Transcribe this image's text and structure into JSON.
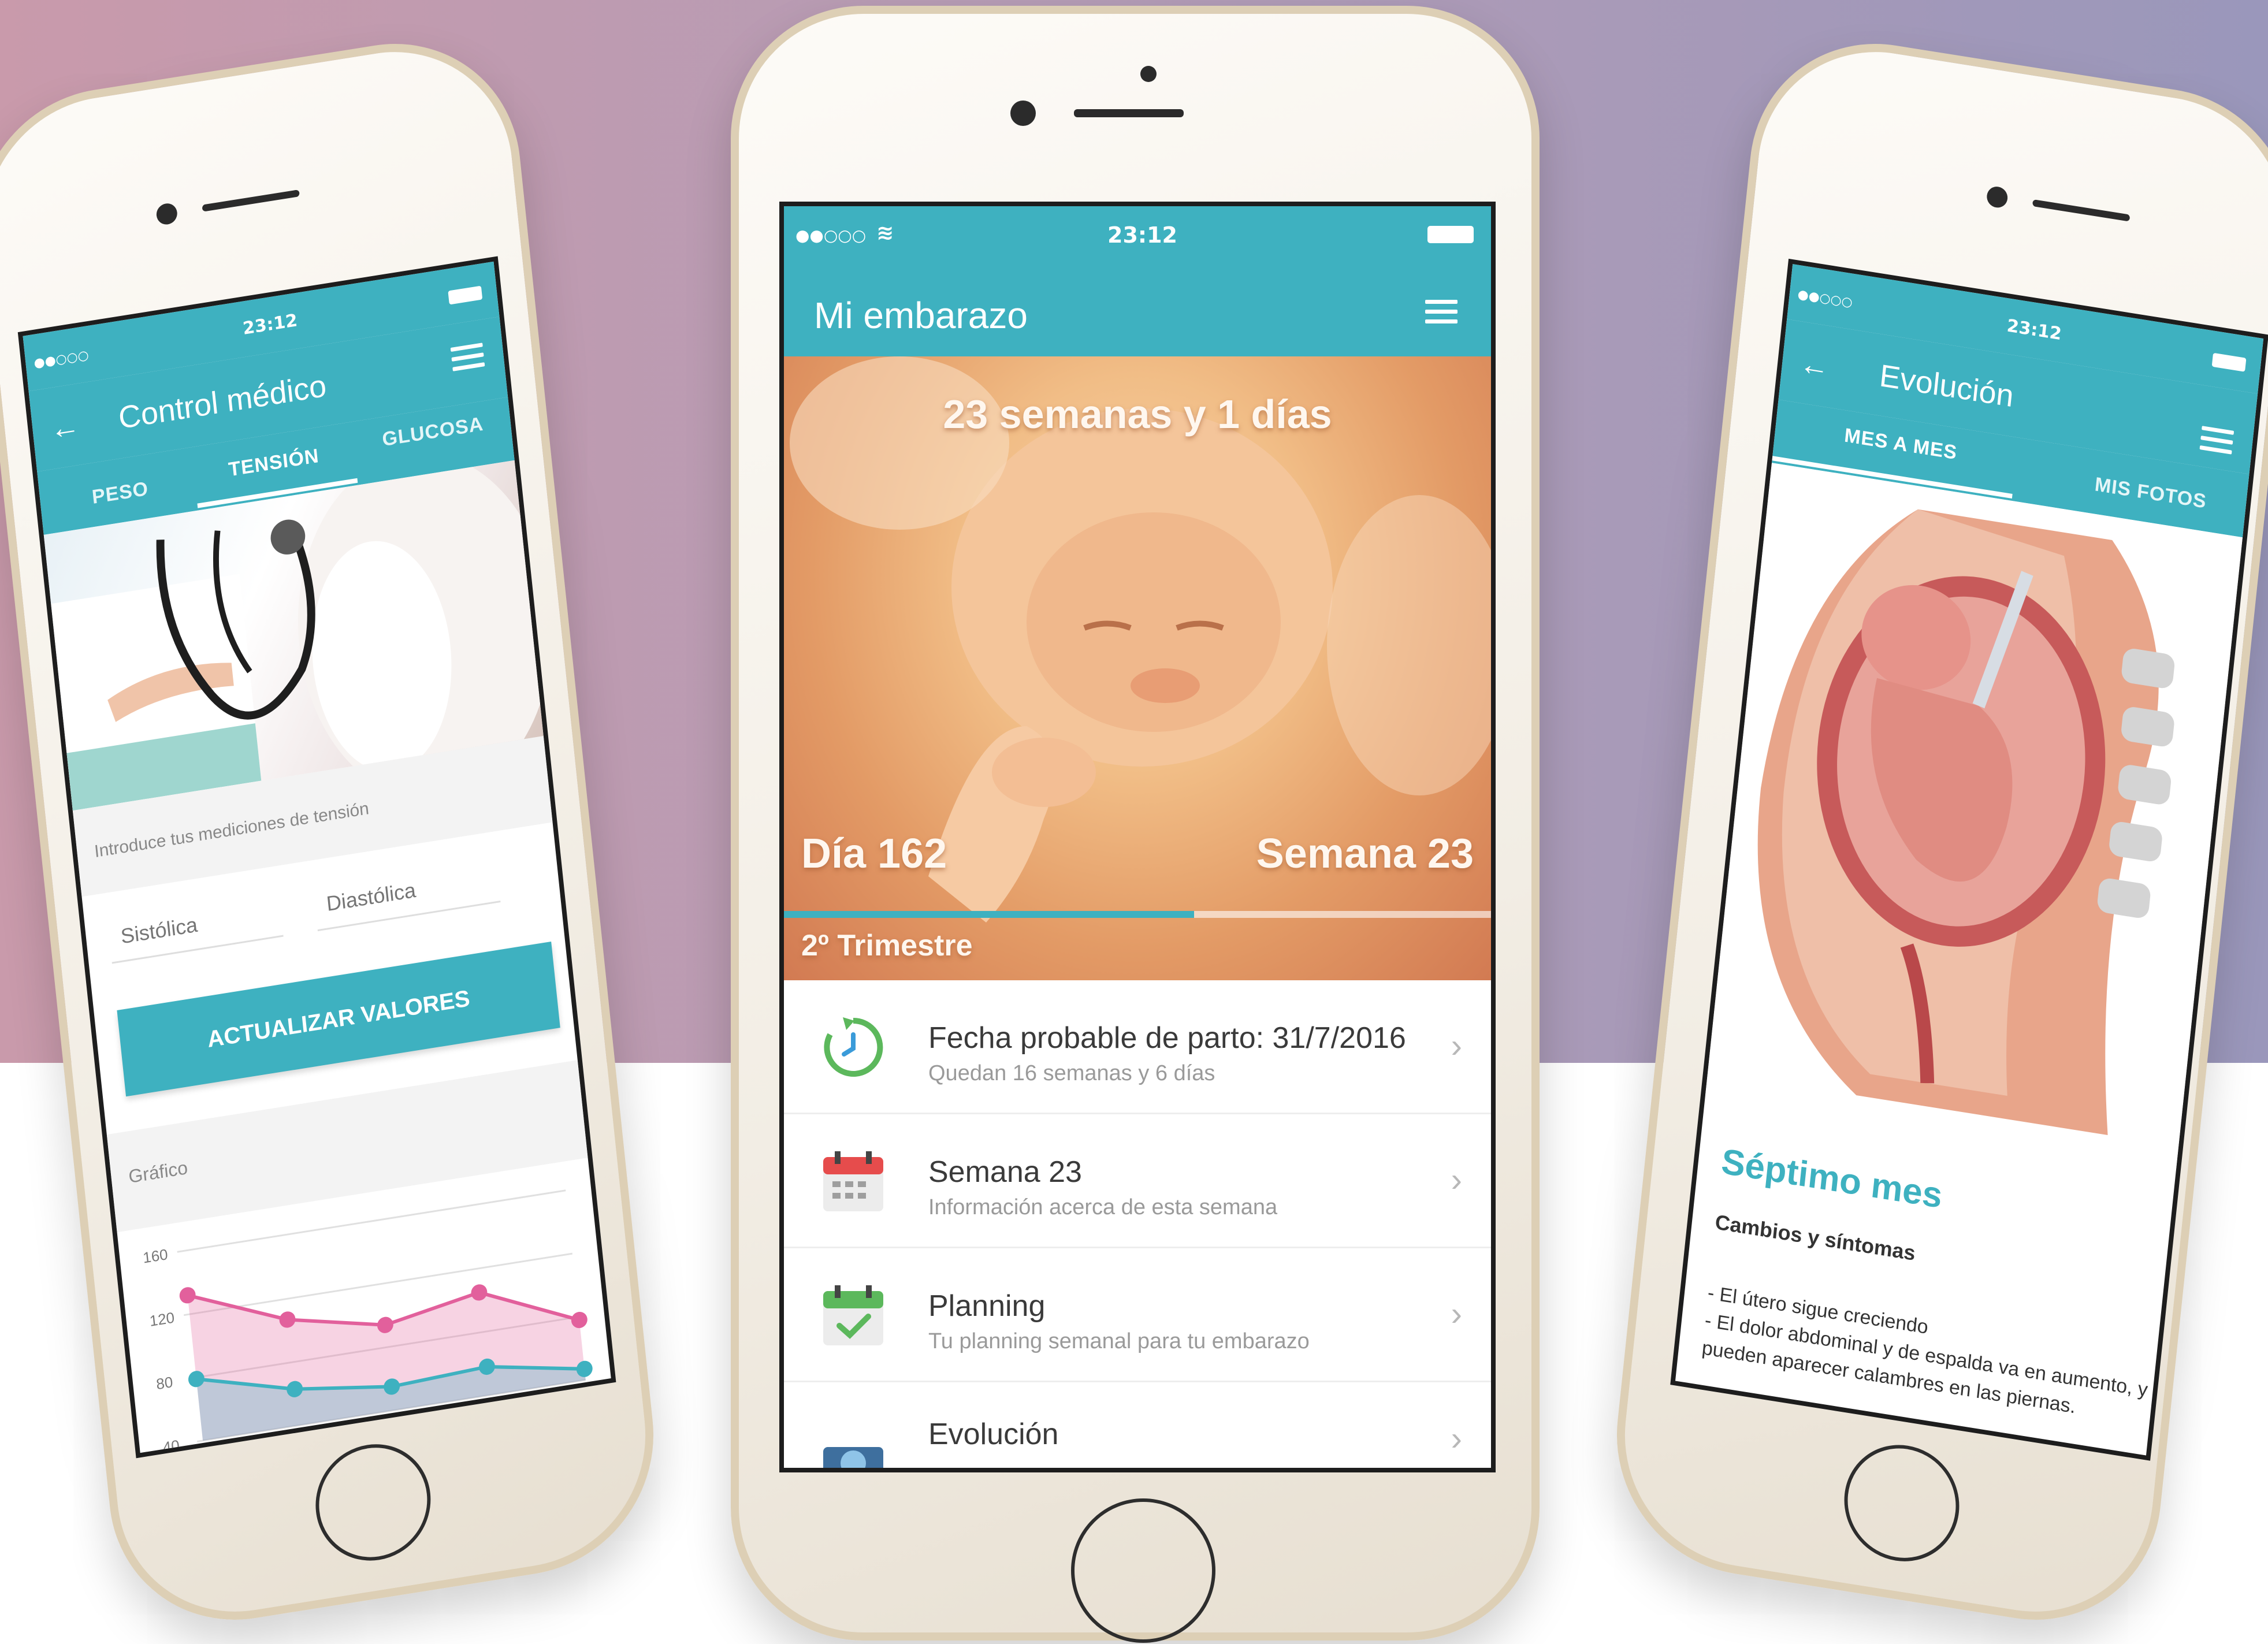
{
  "colors": {
    "teal": "#3eb1c0",
    "pink_series": "#e2609c",
    "blue_series": "#3eb1c0"
  },
  "left": {
    "status": {
      "carrier": "●●○○○",
      "time": "23:12"
    },
    "appbar": {
      "back_icon": "arrow-left-icon",
      "title": "Control médico",
      "menu_icon": "hamburger-icon"
    },
    "tabs": [
      {
        "label": "PESO"
      },
      {
        "label": "TENSIÓN"
      },
      {
        "label": "GLUCOSA"
      }
    ],
    "prompt": "Introduce tus mediciones de tensión",
    "systolic_placeholder": "Sistólica",
    "diastolic_placeholder": "Diastólica",
    "update_button": "ACTUALIZAR VALORES",
    "chart_title": "Gráfico"
  },
  "center": {
    "status": {
      "carrier": "●●○○○",
      "time": "23:12"
    },
    "appbar": {
      "title": "Mi embarazo",
      "menu_icon": "hamburger-icon"
    },
    "hero": {
      "headline": "23 semanas y 1 días",
      "day": "Día 162",
      "week": "Semana 23",
      "trimester": "2º Trimestre",
      "progress": 0.58
    },
    "items": [
      {
        "icon": "clock-refresh-icon",
        "title": "Fecha probable de parto: 31/7/2016",
        "subtitle": "Quedan 16 semanas y 6 días"
      },
      {
        "icon": "calendar-icon",
        "title": "Semana 23",
        "subtitle": "Información acerca de esta semana"
      },
      {
        "icon": "calendar-check-icon",
        "title": "Planning",
        "subtitle": "Tu planning semanal para tu embarazo"
      },
      {
        "icon": "camera-icon",
        "title": "Evolución",
        "subtitle": ""
      }
    ]
  },
  "right": {
    "status": {
      "carrier": "●●○○○",
      "time": "23:12"
    },
    "appbar": {
      "back_icon": "arrow-left-icon",
      "title": "Evolución",
      "menu_icon": "hamburger-icon"
    },
    "tabs": [
      {
        "label": "MES A MES"
      },
      {
        "label": "MIS FOTOS"
      }
    ],
    "section_title": "Séptimo mes",
    "subheading": "Cambios y síntomas",
    "bullets": [
      "- El útero sigue creciendo",
      "- El dolor abdominal y de espalda va en aumento, y",
      "pueden aparecer calambres en las piernas."
    ]
  },
  "chart_data": {
    "type": "area",
    "title": "Gráfico",
    "ylim": [
      40,
      160
    ],
    "y_ticks": [
      "160",
      "120",
      "80",
      "40"
    ],
    "x": [
      1,
      2,
      3,
      4,
      5
    ],
    "series": [
      {
        "values": [
          132,
          107,
          94,
          105,
          78
        ]
      },
      {
        "values": [
          79,
          63,
          55,
          58,
          47
        ]
      }
    ],
    "grid": true
  }
}
